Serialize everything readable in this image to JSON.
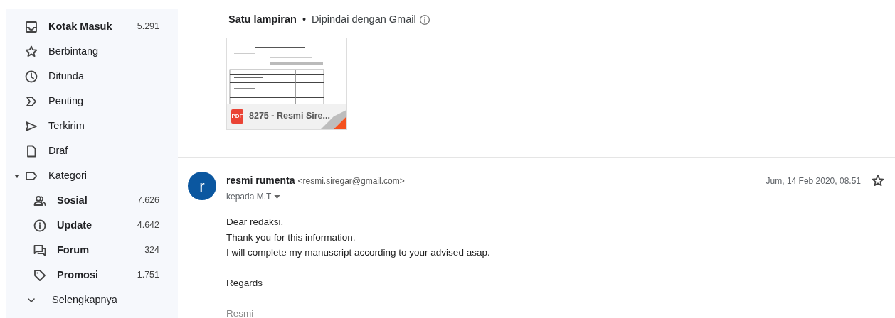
{
  "sidebar": {
    "items": [
      {
        "kind": "folder",
        "label": "Kotak Masuk",
        "count": "5.291",
        "unread": true
      },
      {
        "kind": "folder",
        "label": "Berbintang",
        "unread": false
      },
      {
        "kind": "folder",
        "label": "Ditunda",
        "unread": false
      },
      {
        "kind": "folder",
        "label": "Penting",
        "unread": false
      },
      {
        "kind": "folder",
        "label": "Terkirim",
        "unread": false
      },
      {
        "kind": "folder",
        "label": "Draf",
        "unread": false
      },
      {
        "kind": "group",
        "label": "Kategori",
        "unread": false,
        "expanded": true,
        "children": [
          {
            "label": "Sosial",
            "count": "7.626",
            "unread": true
          },
          {
            "label": "Update",
            "count": "4.642",
            "unread": true
          },
          {
            "label": "Forum",
            "count": "324",
            "unread": true
          },
          {
            "label": "Promosi",
            "count": "1.751",
            "unread": true
          }
        ]
      },
      {
        "kind": "more",
        "label": "Selengkapnya",
        "unread": false
      }
    ]
  },
  "attachments": {
    "title": "Satu lampiran",
    "separator": "•",
    "scan_note": "Dipindai dengan Gmail",
    "files": [
      {
        "kind": "picture",
        "type_label": "PDF",
        "name": "8275 - Resmi Sire..."
      }
    ]
  },
  "message": {
    "avatar_letter": "r",
    "sender_name": "resmi rumenta",
    "sender_email": "<resmi.siregar@gmail.com>",
    "recipient": "kepada M.T",
    "date": "Jum, 14 Feb 2020, 08.51",
    "starred": false,
    "body": [
      [
        "Dear redaksi,",
        "Thank you for this information.",
        "I will complete my manuscript according to your advised asap."
      ],
      [
        "Regards"
      ]
    ],
    "signature": "Resmi"
  }
}
